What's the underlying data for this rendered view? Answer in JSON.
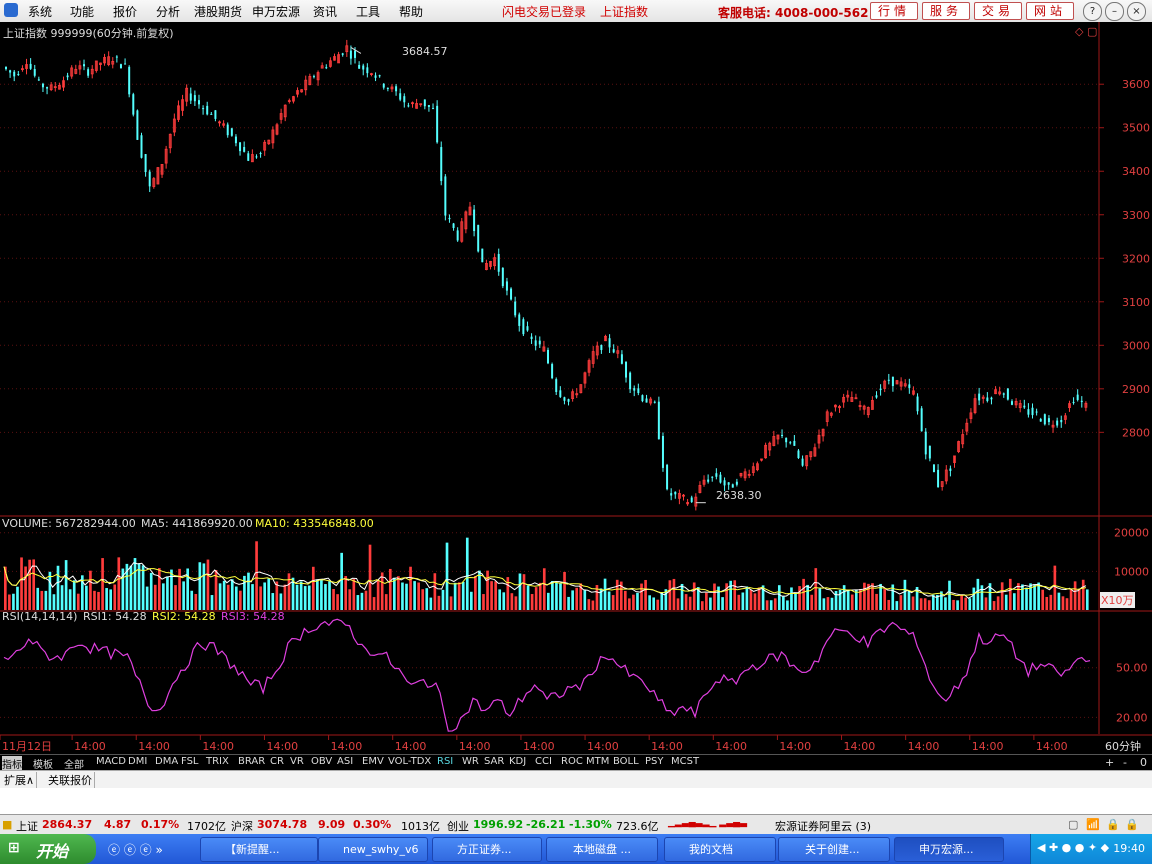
{
  "menu": {
    "items": [
      "系统",
      "功能",
      "报价",
      "分析",
      "港股期货",
      "申万宏源",
      "资讯",
      "工具",
      "帮助"
    ],
    "login_status": "闪电交易已登录",
    "index_link": "上证指数",
    "hotline": "客服电话: 4008-000-562",
    "buttons": [
      "行情",
      "服务",
      "交易",
      "网站"
    ],
    "window_controls": [
      "help-icon",
      "minimize-icon",
      "restore-icon",
      "close-icon"
    ]
  },
  "price_panel": {
    "title": "上证指数 999999(60分钟.前复权)",
    "high_label": "3684.57",
    "low_label": "2638.30",
    "y_ticks": [
      "3600",
      "3500",
      "3400",
      "3300",
      "3200",
      "3100",
      "3000",
      "2900",
      "2800"
    ]
  },
  "volume_panel": {
    "label": "VOLUME: 567282944.00",
    "ma5_label": "MA5: 441869920.00",
    "ma10_label": "MA10: 433546848.00",
    "y_ticks": [
      "20000",
      "10000"
    ],
    "unit": "X10万"
  },
  "rsi_panel": {
    "label": "RSI(14,14,14)",
    "rsi1_label": "RSI1: 54.28",
    "rsi2_label": "RSI2: 54.28",
    "rsi3_label": "RSI3: 54.28",
    "y_ticks": [
      "50.00",
      "20.00"
    ]
  },
  "x_axis": {
    "labels": [
      "11月12日",
      "14:00",
      "14:00",
      "14:00",
      "14:00",
      "14:00",
      "14:00",
      "14:00",
      "14:00",
      "14:00",
      "14:00",
      "14:00",
      "14:00",
      "14:00",
      "14:00",
      "14:00",
      "14:00"
    ],
    "period": "60分钟"
  },
  "indicator_tabs": [
    "指标",
    "模板",
    "全部",
    "MACD",
    "DMI",
    "DMA",
    "FSL",
    "TRIX",
    "BRAR",
    "CR",
    "VR",
    "OBV",
    "ASI",
    "EMV",
    "VOL-TDX",
    "RSI",
    "WR",
    "SAR",
    "KDJ",
    "CCI",
    "ROC",
    "MTM",
    "BOLL",
    "PSY",
    "MCST"
  ],
  "active_tab": "RSI",
  "tab_controls": [
    "+",
    "-",
    "0"
  ],
  "sub_tabs": [
    "扩展∧",
    "关联报价"
  ],
  "status_bar": {
    "sh_name": "上证",
    "sh_price": "2864.37",
    "sh_change": "4.87",
    "sh_pct": "0.17%",
    "sh_amount": "1702亿",
    "hs_name": "沪深",
    "hs_price": "3074.78",
    "hs_change": "9.09",
    "hs_pct": "0.30%",
    "hs_amount": "1013亿",
    "cy_name": "创业",
    "cy_price": "1996.92",
    "cy_change": "-26.21",
    "cy_pct": "-1.30%",
    "cy_amount": "723.6亿",
    "server": "宏源证券阿里云 (3)"
  },
  "taskbar": {
    "start_label": "开始",
    "tasks": [
      "【新提醒...",
      "new_swhy_v6",
      "方正证券...",
      "本地磁盘 ...",
      "我的文档",
      "关于创建...",
      "申万宏源..."
    ],
    "clock": "19:40"
  },
  "colors": {
    "up": "#ff3c3c",
    "down": "#54ffff",
    "axis": "#a01818",
    "ma5": "#ffffff",
    "ma10": "#ffff3c",
    "rsi": "#e040e0"
  },
  "chart_data": [
    {
      "type": "candlestick",
      "series": [
        {
          "name": "上证指数 999999",
          "close_path": [
            3640,
            3620,
            3655,
            3600,
            3590,
            3610,
            3640,
            3630,
            3650,
            3660,
            3640,
            3480,
            3360,
            3420,
            3520,
            3580,
            3555,
            3530,
            3500,
            3470,
            3430,
            3440,
            3490,
            3550,
            3580,
            3610,
            3640,
            3660,
            3684.57,
            3640,
            3630,
            3600,
            3580,
            3550,
            3560,
            3540,
            3300,
            3250,
            3320,
            3180,
            3200,
            3120,
            3050,
            3010,
            2990,
            2900,
            2870,
            2910,
            2980,
            3010,
            2980,
            2910,
            2880,
            2860,
            2660,
            2650,
            2638.3,
            2690,
            2700,
            2670,
            2700,
            2720,
            2760,
            2790,
            2780,
            2720,
            2770,
            2840,
            2870,
            2880,
            2850,
            2890,
            2920,
            2910,
            2890,
            2760,
            2680,
            2720,
            2800,
            2880,
            2880,
            2900,
            2870,
            2850,
            2840,
            2820,
            2830,
            2880,
            2860
          ]
        }
      ],
      "high": 3684.57,
      "low": 2638.3,
      "ylim": [
        2610,
        3720
      ]
    },
    {
      "type": "bar",
      "series": [
        {
          "name": "VOLUME"
        },
        {
          "name": "MA5"
        },
        {
          "name": "MA10"
        }
      ],
      "ylim": [
        0,
        22000
      ]
    },
    {
      "type": "line",
      "series": [
        {
          "name": "RSI1",
          "values": [
            55,
            58,
            68,
            60,
            56,
            58,
            66,
            62,
            60,
            58,
            56,
            40,
            24,
            30,
            45,
            55,
            65,
            62,
            55,
            48,
            40,
            38,
            48,
            62,
            70,
            75,
            77,
            76,
            75,
            62,
            60,
            56,
            48,
            38,
            42,
            40,
            14,
            18,
            30,
            24,
            30,
            22,
            32,
            40,
            30,
            34,
            38,
            40,
            52,
            58,
            50,
            44,
            40,
            30,
            22,
            26,
            22,
            36,
            44,
            40,
            48,
            52,
            55,
            58,
            50,
            48,
            56,
            70,
            72,
            70,
            64,
            72,
            76,
            72,
            66,
            44,
            30,
            36,
            48,
            68,
            66,
            70,
            58,
            48,
            52,
            48,
            46,
            55,
            54.28
          ]
        }
      ],
      "ylim": [
        10,
        80
      ]
    }
  ]
}
